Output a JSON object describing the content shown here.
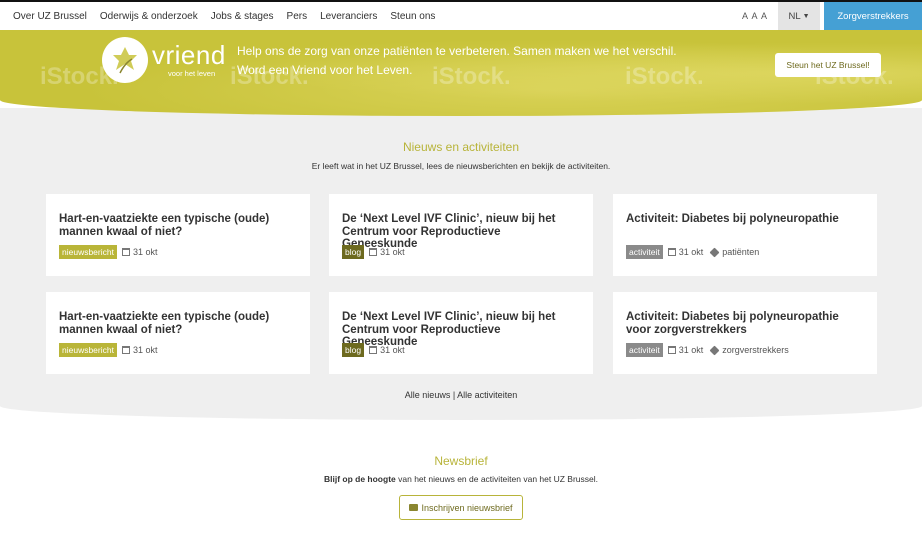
{
  "nav": {
    "links": [
      "Over UZ Brussel",
      "Oderwijs & onderzoek",
      "Jobs & stages",
      "Pers",
      "Leveranciers",
      "Steun ons"
    ],
    "font_size_label": "A A A",
    "lang": "NL",
    "zorg_button": "Zorgverstrekkers"
  },
  "hero": {
    "logo_word": "vriend",
    "logo_sub": "voor het leven",
    "line1": "Help ons de zorg van onze patiënten te verbeteren. Samen maken we het verschil.",
    "line2": "Word een Vriend voor het Leven.",
    "watermark": "iStock.",
    "button": "Steun het UZ Brussel!"
  },
  "news": {
    "title": "Nieuws en activiteiten",
    "subtitle": "Er leeft wat in het UZ Brussel, lees de nieuwsberichten en bekijk de activiteiten.",
    "cards": [
      {
        "title": "Hart-en-vaatziekte een typische (oude) mannen kwaal of niet?",
        "badge": "nieuwsbericht",
        "date": "31 okt",
        "tag": ""
      },
      {
        "title": "De ‘Next Level IVF Clinic’, nieuw bij het Centrum voor Reproductieve Geneeskunde",
        "badge": "blog",
        "date": "31 okt",
        "tag": ""
      },
      {
        "title": "Activiteit: Diabetes bij polyneuropathie",
        "badge": "activiteit",
        "date": "31 okt",
        "tag": "patiënten"
      },
      {
        "title": "Hart-en-vaatziekte een typische (oude) mannen kwaal of niet?",
        "badge": "nieuwsbericht",
        "date": "31 okt",
        "tag": ""
      },
      {
        "title": "De ‘Next Level IVF Clinic’, nieuw bij het Centrum voor Reproductieve Geneeskunde",
        "badge": "blog",
        "date": "31 okt",
        "tag": ""
      },
      {
        "title": "Activiteit: Diabetes bij polyneuropathie voor zorgverstrekkers",
        "badge": "activiteit",
        "date": "31 okt",
        "tag": "zorgverstrekkers"
      }
    ],
    "all_news": "Alle nieuws",
    "separator": " | ",
    "all_activities": "Alle activiteiten"
  },
  "newsletter": {
    "title": "Newsbrief",
    "sub_bold": "Blijf op de hoogte",
    "sub_rest": " van het nieuws en de activiteiten van het UZ Brussel.",
    "button": "Inschrijven nieuwsbrief"
  },
  "colors": {
    "accent": "#b8b43a",
    "hero": "#c8c33a",
    "blue": "#45a0d4"
  }
}
